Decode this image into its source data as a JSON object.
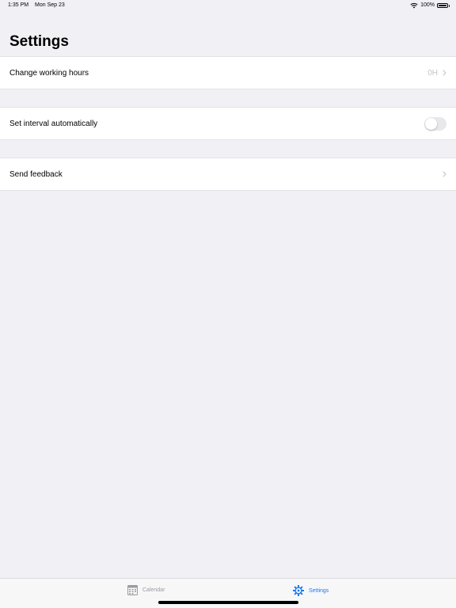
{
  "status_bar": {
    "time": "1:35 PM",
    "date": "Mon Sep 23",
    "battery": "100%"
  },
  "page": {
    "title": "Settings"
  },
  "settings": {
    "working_hours": {
      "label": "Change working hours",
      "value": "0H"
    },
    "interval": {
      "label": "Set interval automatically",
      "enabled": false
    },
    "feedback": {
      "label": "Send feedback"
    }
  },
  "tab_bar": {
    "tabs": [
      {
        "label": "Calendar",
        "icon": "calendar-icon",
        "selected": false
      },
      {
        "label": "Settings",
        "icon": "gear-icon",
        "selected": true
      }
    ]
  },
  "colors": {
    "accent": "#1a7cf5",
    "background": "#f1f0f5",
    "inactive_tab": "#9c9ca0"
  }
}
